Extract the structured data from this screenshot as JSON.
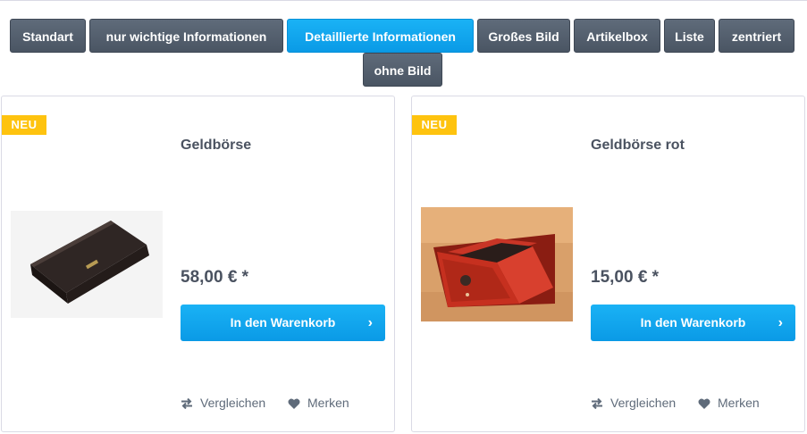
{
  "tabs": [
    {
      "label": "Standart",
      "active": false
    },
    {
      "label": "nur wichtige Informationen",
      "active": false
    },
    {
      "label": "Detaillierte Informationen",
      "active": true
    },
    {
      "label": "Großes Bild",
      "active": false
    },
    {
      "label": "Artikelbox",
      "active": false
    },
    {
      "label": "Liste",
      "active": false
    },
    {
      "label": "zentriert",
      "active": false
    },
    {
      "label": "ohne Bild",
      "active": false
    }
  ],
  "products": [
    {
      "badge": "NEU",
      "name": "Geldbörse",
      "price": "58,00 € *",
      "buy_label": "In den Warenkorb",
      "compare_label": "Vergleichen",
      "wishlist_label": "Merken"
    },
    {
      "badge": "NEU",
      "name": "Geldbörse rot",
      "price": "15,00 € *",
      "buy_label": "In den Warenkorb",
      "compare_label": "Vergleichen",
      "wishlist_label": "Merken"
    }
  ],
  "colors": {
    "accent": "#0a9ae6",
    "tab_dark": "#4a5563",
    "badge": "#fec30f"
  }
}
